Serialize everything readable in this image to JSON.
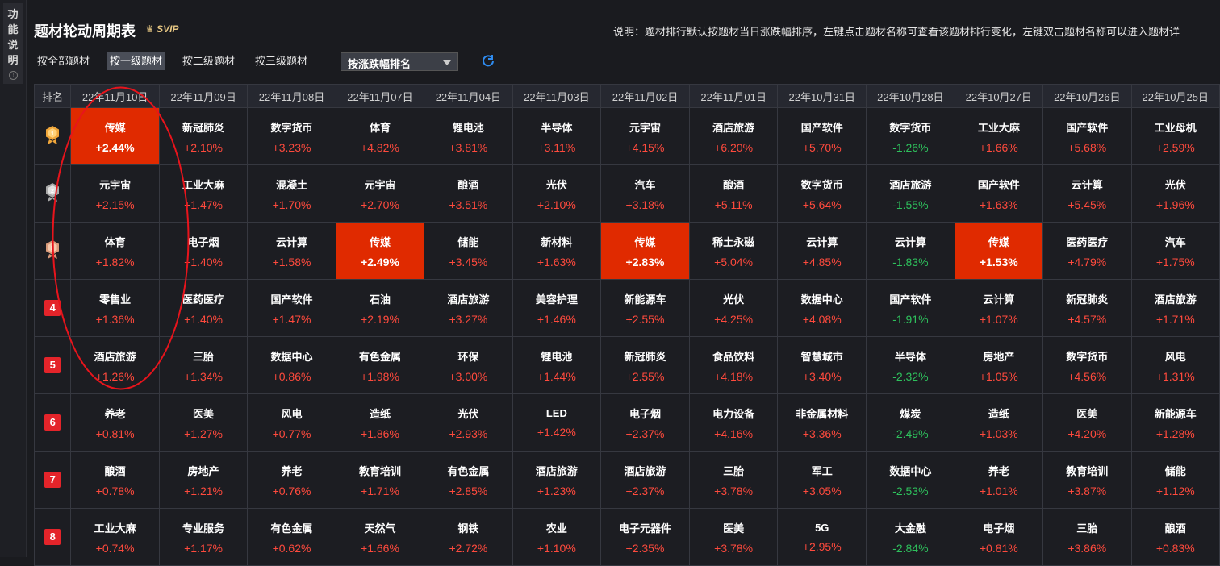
{
  "sidebar": {
    "label": "功能说明"
  },
  "header": {
    "title": "题材轮动周期表",
    "badge": "SVIP",
    "description": "说明：题材排行默认按题材当日涨跌幅排序，左键点击题材名称可查看该题材排行变化，左键双击题材名称可以进入题材详"
  },
  "filters": {
    "all": "按全部题材",
    "level1": "按一级题材",
    "level2": "按二级题材",
    "level3": "按三级题材",
    "sort_value": "按涨跌幅排名"
  },
  "colors": {
    "up": "#ff4a3d",
    "down": "#2ec05c",
    "highlight": "#e02a00",
    "rank_badge": "#e4242a"
  },
  "table": {
    "rank_header": "排名",
    "dates": [
      "22年11月10日",
      "22年11月09日",
      "22年11月08日",
      "22年11月07日",
      "22年11月04日",
      "22年11月03日",
      "22年11月02日",
      "22年11月01日",
      "22年10月31日",
      "22年10月28日",
      "22年10月27日",
      "22年10月26日",
      "22年10月25日"
    ],
    "rows": [
      {
        "rank": "1",
        "medal": "gold-medal-icon",
        "cells": [
          {
            "n": "传媒",
            "p": "+2.44%",
            "hl": true
          },
          {
            "n": "新冠肺炎",
            "p": "+2.10%"
          },
          {
            "n": "数字货币",
            "p": "+3.23%"
          },
          {
            "n": "体育",
            "p": "+4.82%"
          },
          {
            "n": "锂电池",
            "p": "+3.81%"
          },
          {
            "n": "半导体",
            "p": "+3.11%"
          },
          {
            "n": "元宇宙",
            "p": "+4.15%"
          },
          {
            "n": "酒店旅游",
            "p": "+6.20%"
          },
          {
            "n": "国产软件",
            "p": "+5.70%"
          },
          {
            "n": "数字货币",
            "p": "-1.26%"
          },
          {
            "n": "工业大麻",
            "p": "+1.66%"
          },
          {
            "n": "国产软件",
            "p": "+5.68%"
          },
          {
            "n": "工业母机",
            "p": "+2.59%"
          }
        ]
      },
      {
        "rank": "2",
        "medal": "silver-medal-icon",
        "cells": [
          {
            "n": "元宇宙",
            "p": "+2.15%"
          },
          {
            "n": "工业大麻",
            "p": "+1.47%"
          },
          {
            "n": "混凝土",
            "p": "+1.70%"
          },
          {
            "n": "元宇宙",
            "p": "+2.70%"
          },
          {
            "n": "酿酒",
            "p": "+3.51%"
          },
          {
            "n": "光伏",
            "p": "+2.10%"
          },
          {
            "n": "汽车",
            "p": "+3.18%"
          },
          {
            "n": "酿酒",
            "p": "+5.11%"
          },
          {
            "n": "数字货币",
            "p": "+5.64%"
          },
          {
            "n": "酒店旅游",
            "p": "-1.55%"
          },
          {
            "n": "国产软件",
            "p": "+1.63%"
          },
          {
            "n": "云计算",
            "p": "+5.45%"
          },
          {
            "n": "光伏",
            "p": "+1.96%"
          }
        ]
      },
      {
        "rank": "3",
        "medal": "bronze-medal-icon",
        "cells": [
          {
            "n": "体育",
            "p": "+1.82%"
          },
          {
            "n": "电子烟",
            "p": "+1.40%"
          },
          {
            "n": "云计算",
            "p": "+1.58%"
          },
          {
            "n": "传媒",
            "p": "+2.49%",
            "hl": true
          },
          {
            "n": "储能",
            "p": "+3.45%"
          },
          {
            "n": "新材料",
            "p": "+1.63%"
          },
          {
            "n": "传媒",
            "p": "+2.83%",
            "hl": true
          },
          {
            "n": "稀土永磁",
            "p": "+5.04%"
          },
          {
            "n": "云计算",
            "p": "+4.85%"
          },
          {
            "n": "云计算",
            "p": "-1.83%"
          },
          {
            "n": "传媒",
            "p": "+1.53%",
            "hl": true
          },
          {
            "n": "医药医疗",
            "p": "+4.79%"
          },
          {
            "n": "汽车",
            "p": "+1.75%"
          }
        ]
      },
      {
        "rank": "4",
        "cells": [
          {
            "n": "零售业",
            "p": "+1.36%"
          },
          {
            "n": "医药医疗",
            "p": "+1.40%"
          },
          {
            "n": "国产软件",
            "p": "+1.47%"
          },
          {
            "n": "石油",
            "p": "+2.19%"
          },
          {
            "n": "酒店旅游",
            "p": "+3.27%"
          },
          {
            "n": "美容护理",
            "p": "+1.46%"
          },
          {
            "n": "新能源车",
            "p": "+2.55%"
          },
          {
            "n": "光伏",
            "p": "+4.25%"
          },
          {
            "n": "数据中心",
            "p": "+4.08%"
          },
          {
            "n": "国产软件",
            "p": "-1.91%"
          },
          {
            "n": "云计算",
            "p": "+1.07%"
          },
          {
            "n": "新冠肺炎",
            "p": "+4.57%"
          },
          {
            "n": "酒店旅游",
            "p": "+1.71%"
          }
        ]
      },
      {
        "rank": "5",
        "cells": [
          {
            "n": "酒店旅游",
            "p": "+1.26%"
          },
          {
            "n": "三胎",
            "p": "+1.34%"
          },
          {
            "n": "数据中心",
            "p": "+0.86%"
          },
          {
            "n": "有色金属",
            "p": "+1.98%"
          },
          {
            "n": "环保",
            "p": "+3.00%"
          },
          {
            "n": "锂电池",
            "p": "+1.44%"
          },
          {
            "n": "新冠肺炎",
            "p": "+2.55%"
          },
          {
            "n": "食品饮料",
            "p": "+4.18%"
          },
          {
            "n": "智慧城市",
            "p": "+3.40%"
          },
          {
            "n": "半导体",
            "p": "-2.32%"
          },
          {
            "n": "房地产",
            "p": "+1.05%"
          },
          {
            "n": "数字货币",
            "p": "+4.56%"
          },
          {
            "n": "风电",
            "p": "+1.31%"
          }
        ]
      },
      {
        "rank": "6",
        "cells": [
          {
            "n": "养老",
            "p": "+0.81%"
          },
          {
            "n": "医美",
            "p": "+1.27%"
          },
          {
            "n": "风电",
            "p": "+0.77%"
          },
          {
            "n": "造纸",
            "p": "+1.86%"
          },
          {
            "n": "光伏",
            "p": "+2.93%"
          },
          {
            "n": "LED",
            "p": "+1.42%"
          },
          {
            "n": "电子烟",
            "p": "+2.37%"
          },
          {
            "n": "电力设备",
            "p": "+4.16%"
          },
          {
            "n": "非金属材料",
            "p": "+3.36%"
          },
          {
            "n": "煤炭",
            "p": "-2.49%"
          },
          {
            "n": "造纸",
            "p": "+1.03%"
          },
          {
            "n": "医美",
            "p": "+4.20%"
          },
          {
            "n": "新能源车",
            "p": "+1.28%"
          }
        ]
      },
      {
        "rank": "7",
        "cells": [
          {
            "n": "酿酒",
            "p": "+0.78%"
          },
          {
            "n": "房地产",
            "p": "+1.21%"
          },
          {
            "n": "养老",
            "p": "+0.76%"
          },
          {
            "n": "教育培训",
            "p": "+1.71%"
          },
          {
            "n": "有色金属",
            "p": "+2.85%"
          },
          {
            "n": "酒店旅游",
            "p": "+1.23%"
          },
          {
            "n": "酒店旅游",
            "p": "+2.37%"
          },
          {
            "n": "三胎",
            "p": "+3.78%"
          },
          {
            "n": "军工",
            "p": "+3.05%"
          },
          {
            "n": "数据中心",
            "p": "-2.53%"
          },
          {
            "n": "养老",
            "p": "+1.01%"
          },
          {
            "n": "教育培训",
            "p": "+3.87%"
          },
          {
            "n": "储能",
            "p": "+1.12%"
          }
        ]
      },
      {
        "rank": "8",
        "cells": [
          {
            "n": "工业大麻",
            "p": "+0.74%"
          },
          {
            "n": "专业服务",
            "p": "+1.17%"
          },
          {
            "n": "有色金属",
            "p": "+0.62%"
          },
          {
            "n": "天然气",
            "p": "+1.66%"
          },
          {
            "n": "钢铁",
            "p": "+2.72%"
          },
          {
            "n": "农业",
            "p": "+1.10%"
          },
          {
            "n": "电子元器件",
            "p": "+2.35%"
          },
          {
            "n": "医美",
            "p": "+3.78%"
          },
          {
            "n": "5G",
            "p": "+2.95%"
          },
          {
            "n": "大金融",
            "p": "-2.84%"
          },
          {
            "n": "电子烟",
            "p": "+0.81%"
          },
          {
            "n": "三胎",
            "p": "+3.86%"
          },
          {
            "n": "酿酒",
            "p": "+0.83%"
          }
        ]
      }
    ]
  }
}
